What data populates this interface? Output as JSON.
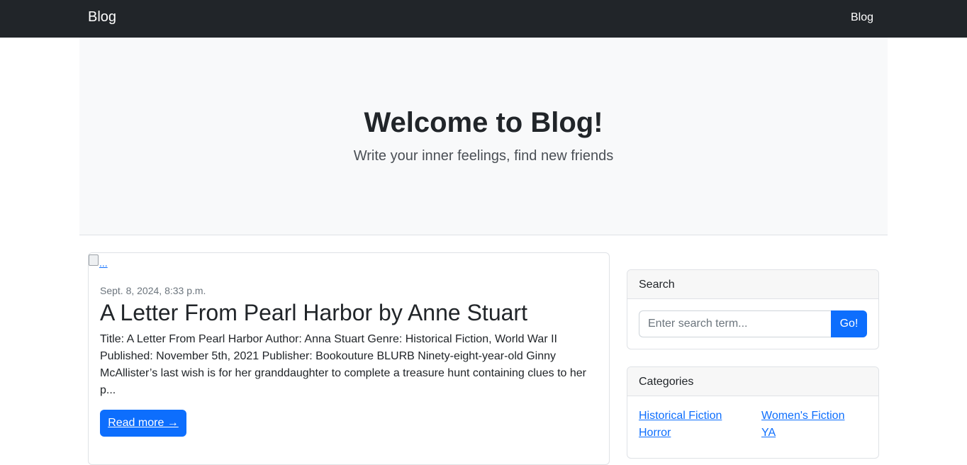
{
  "navbar": {
    "brand": "Blog",
    "links": [
      "Blog"
    ]
  },
  "hero": {
    "title": "Welcome to Blog!",
    "subtitle": "Write your inner feelings, find new friends"
  },
  "post": {
    "image_alt": "...",
    "date": "Sept. 8, 2024, 8:33 p.m.",
    "title": "A Letter From Pearl Harbor by Anne Stuart",
    "excerpt": "Title: A Letter From Pearl Harbor Author: Anna Stuart Genre: Historical Fiction, World War II Published: November 5th, 2021 Publisher: Bookouture BLURB Ninety-eight-year-old Ginny McAllister’s last wish is for her granddaughter to complete a treasure hunt containing clues to her p...",
    "read_more": "Read more →"
  },
  "sidebar": {
    "search": {
      "header": "Search",
      "placeholder": "Enter search term...",
      "button": "Go!"
    },
    "categories": {
      "header": "Categories",
      "items": [
        "Historical Fiction",
        "Women's Fiction",
        "Horror",
        "YA"
      ]
    }
  },
  "colors": {
    "navbar": "#212529",
    "primary": "#0d6efd",
    "hero_bg": "#f8f9fa"
  }
}
